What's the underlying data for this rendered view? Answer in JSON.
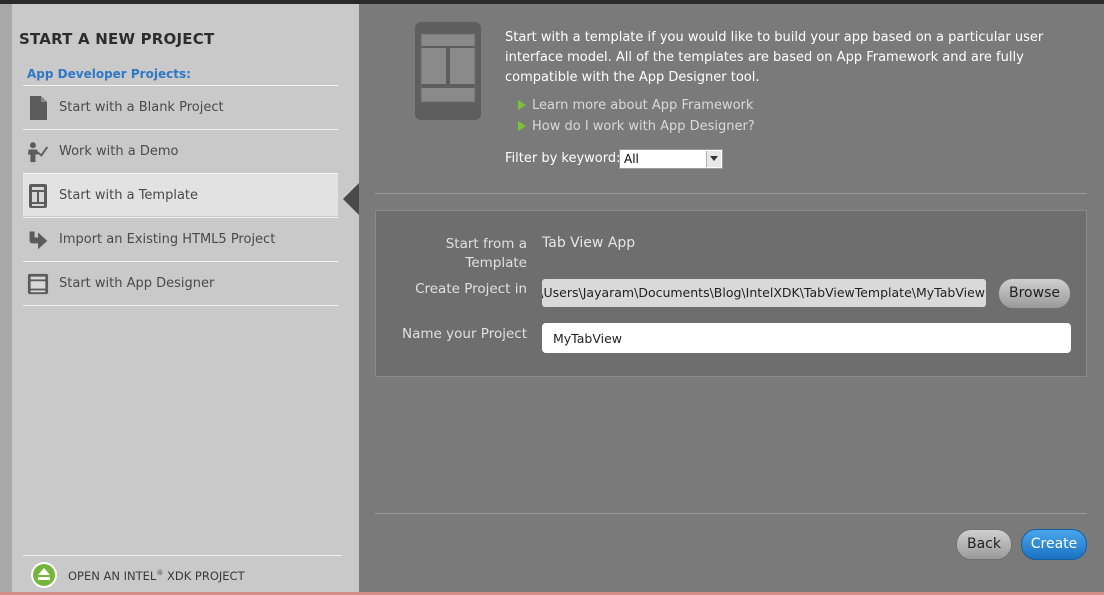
{
  "sidebar": {
    "title": "START A NEW PROJECT",
    "section_label": "App Developer Projects:",
    "items": [
      {
        "label": "Start with a Blank Project",
        "icon": "blank-document-icon"
      },
      {
        "label": "Work with a Demo",
        "icon": "demo-presenter-icon"
      },
      {
        "label": "Start with a Template",
        "icon": "template-icon",
        "selected": true
      },
      {
        "label": "Import an Existing HTML5 Project",
        "icon": "import-arrow-icon"
      },
      {
        "label": "Start with App Designer",
        "icon": "app-designer-icon"
      }
    ],
    "open_project_label": "OPEN AN INTEL",
    "open_project_sup": "®",
    "open_project_suffix": " XDK PROJECT",
    "open_project_icon": "eject-icon"
  },
  "main": {
    "description": "Start with a template if you would like to build your app based on a particular user interface model. All of the templates are based on App Framework and are fully compatible with the App Designer tool.",
    "links": [
      {
        "label": "Learn more about App Framework"
      },
      {
        "label": "How do I work with App Designer?"
      }
    ],
    "filter": {
      "label": "Filter by keyword:",
      "value": "All"
    },
    "form": {
      "template_label": "Start from a Template",
      "template_label_line1": "Start from a",
      "template_label_line2": "Template",
      "template_value": "Tab View App",
      "location_label": "Create Project in",
      "location_value": "C:\\Users\\Jayaram\\Documents\\Blog\\IntelXDK\\TabViewTemplate\\MyTabView",
      "browse_label": "Browse",
      "name_label": "Name your Project",
      "name_value": "MyTabView"
    },
    "buttons": {
      "back": "Back",
      "create": "Create"
    }
  },
  "colors": {
    "accent": "#2f78c4",
    "link_arrow": "#7cc043",
    "create_button": "#1a72c2",
    "sidebar_bg": "#c9c9c9",
    "main_bg": "#7a7a7a"
  }
}
